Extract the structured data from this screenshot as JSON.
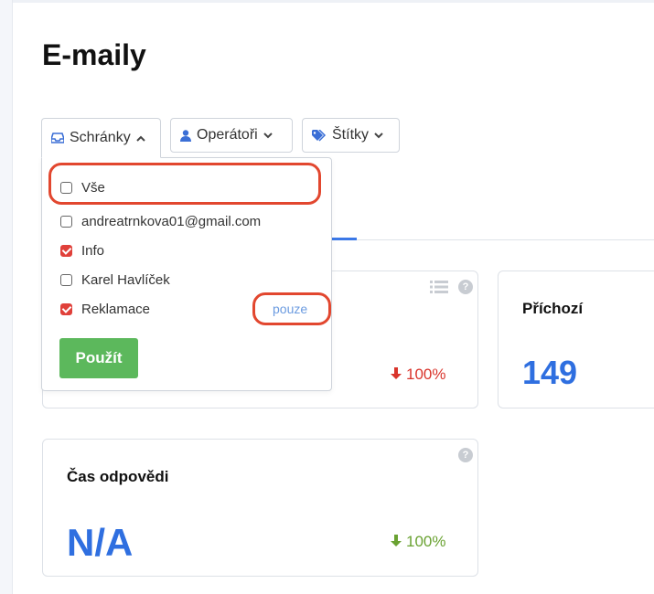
{
  "page": {
    "title": "E-maily"
  },
  "filters": {
    "mailboxes": {
      "label": "Schránky",
      "icon": "inbox-icon",
      "state": "open"
    },
    "operators": {
      "label": "Operátoři",
      "icon": "user-icon"
    },
    "tags": {
      "label": "Štítky",
      "icon": "tags-icon"
    }
  },
  "dropdown": {
    "items": [
      {
        "label": "Vše",
        "checked": false
      },
      {
        "label": "andreatrnkova01@gmail.com",
        "checked": false
      },
      {
        "label": "Info",
        "checked": true
      },
      {
        "label": "Karel Havlíček",
        "checked": false
      },
      {
        "label": "Reklamace",
        "checked": true
      }
    ],
    "only_label": "pouze",
    "apply_label": "Použít"
  },
  "cards": {
    "first": {
      "delta": "100%",
      "delta_direction": "down",
      "delta_color": "#d9342b"
    },
    "incoming": {
      "title": "Příchozí",
      "value": "149"
    },
    "response_time": {
      "title": "Čas odpovědi",
      "value": "N/A",
      "delta": "100%",
      "delta_direction": "down",
      "delta_color": "#6aa232"
    }
  },
  "colors": {
    "accent": "#2f6fe0",
    "highlight": "#e2472f",
    "apply": "#5cb85c"
  }
}
